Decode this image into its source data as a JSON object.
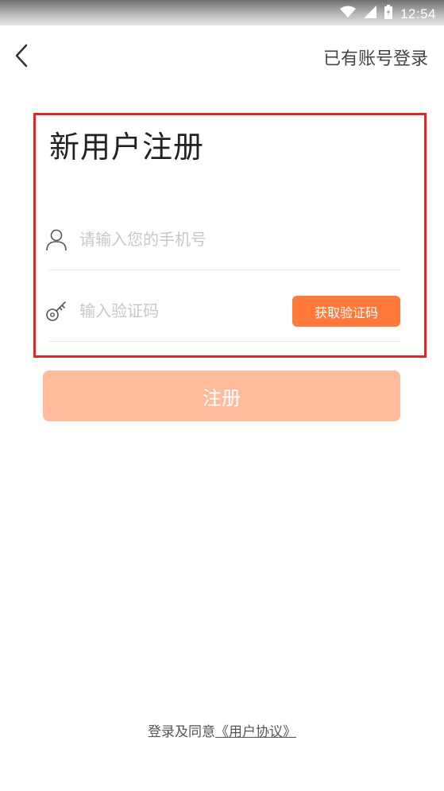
{
  "status_bar": {
    "time": "12:54",
    "icons": [
      "wifi-icon",
      "signal-icon",
      "battery-icon"
    ]
  },
  "nav": {
    "back_icon": "chevron-left-icon",
    "login_link": "已有账号登录"
  },
  "form": {
    "title": "新用户注册",
    "phone": {
      "icon": "user-icon",
      "value": "",
      "placeholder": "请输入您的手机号"
    },
    "code": {
      "icon": "key-icon",
      "value": "",
      "placeholder": "输入验证码",
      "button_label": "获取验证码"
    },
    "submit_label": "注册"
  },
  "footer": {
    "agreement_prefix": "登录及同意",
    "agreement_link": "《用户协议》"
  },
  "colors": {
    "accent": "#ff7a3a",
    "submit_disabled": "#ffbb9a",
    "highlight": "#d62b2b"
  }
}
